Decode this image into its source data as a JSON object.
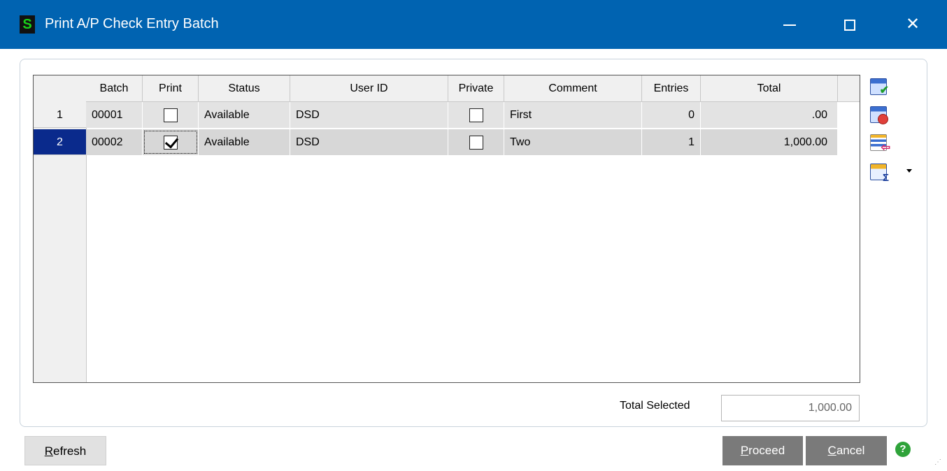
{
  "window": {
    "app_icon_letter": "S",
    "title": "Print A/P Check Entry Batch",
    "minimize_glyph": "—",
    "maximize_glyph": "☐",
    "close_glyph": "✕"
  },
  "grid": {
    "columns": [
      "Batch",
      "Print",
      "Status",
      "User ID",
      "Private",
      "Comment",
      "Entries",
      "Total"
    ],
    "rows": [
      {
        "num": "1",
        "batch": "00001",
        "print": false,
        "status": "Available",
        "user_id": "DSD",
        "private": false,
        "comment": "First",
        "entries": "0",
        "total": ".00",
        "selected": false
      },
      {
        "num": "2",
        "batch": "00002",
        "print": true,
        "status": "Available",
        "user_id": "DSD",
        "private": false,
        "comment": "Two",
        "entries": "1",
        "total": "1,000.00",
        "selected": true
      }
    ]
  },
  "toolbar": {
    "icons": [
      "select-all-icon",
      "clear-selection-icon",
      "grid-export-icon",
      "grid-totals-icon"
    ]
  },
  "summary": {
    "total_selected_label": "Total Selected",
    "total_selected_value": "1,000.00"
  },
  "buttons": {
    "refresh_prefix": "R",
    "refresh_rest": "efresh",
    "proceed_prefix": "P",
    "proceed_rest": "roceed",
    "cancel_prefix": "C",
    "cancel_rest": "ancel",
    "help_glyph": "?"
  },
  "colors": {
    "titlebar": "#0063b1",
    "selected_row": "#0a2a8c",
    "button_dark": "#7a7a7a"
  }
}
